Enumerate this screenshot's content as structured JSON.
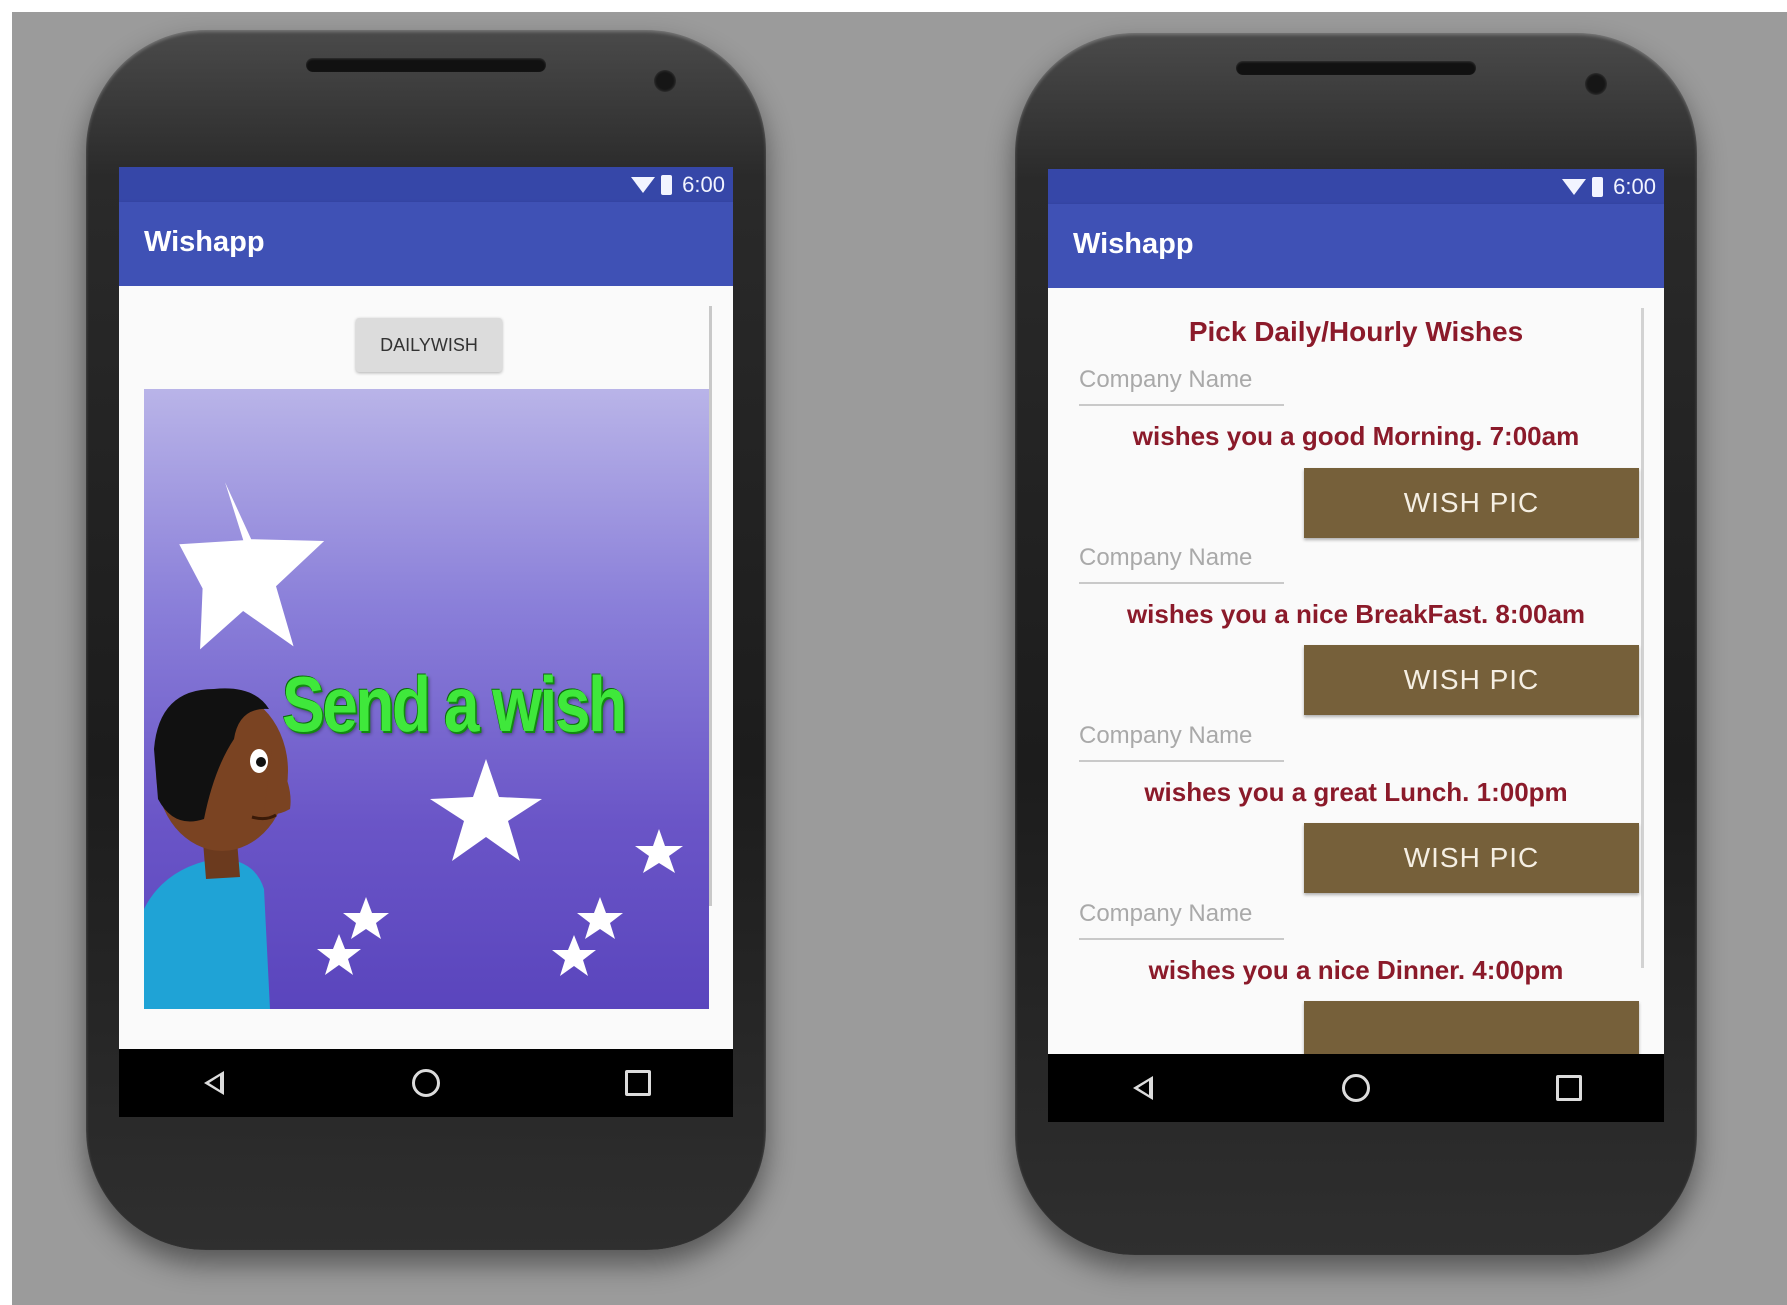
{
  "screens": {
    "left": {
      "status_time": "6:00",
      "app_title": "Wishapp",
      "dailywish_label": "DAILYWISH",
      "image_text": "Send a wish"
    },
    "right": {
      "status_time": "6:00",
      "app_title": "Wishapp",
      "heading": "Pick Daily/Hourly Wishes",
      "wishes": [
        {
          "company_placeholder": "Company Name",
          "message": "wishes you a good Morning. 7:00am",
          "button_label": "WISH PIC"
        },
        {
          "company_placeholder": "Company Name",
          "message": "wishes you a nice BreakFast. 8:00am",
          "button_label": "WISH PIC"
        },
        {
          "company_placeholder": "Company Name",
          "message": "wishes you a great Lunch. 1:00pm",
          "button_label": "WISH PIC"
        },
        {
          "company_placeholder": "Company Name",
          "message": "wishes you a nice Dinner. 4:00pm",
          "button_label": ""
        }
      ]
    }
  },
  "icons": [
    "wifi-icon",
    "battery-icon",
    "back-icon",
    "home-icon",
    "recent-apps-icon"
  ],
  "colors": {
    "appbar": "#3f51b5",
    "statusbar": "#3647a8",
    "wish_text": "#8b1a2a",
    "wishpic_button": "#76603a",
    "image_text": "#3fe83b"
  }
}
